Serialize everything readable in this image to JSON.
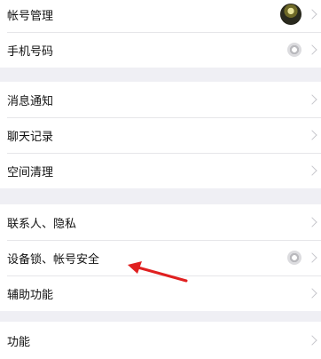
{
  "group1": {
    "items": [
      {
        "label": "帐号管理"
      },
      {
        "label": "手机号码"
      }
    ]
  },
  "group2": {
    "items": [
      {
        "label": "消息通知"
      },
      {
        "label": "聊天记录"
      },
      {
        "label": "空间清理"
      }
    ]
  },
  "group3": {
    "items": [
      {
        "label": "联系人、隐私"
      },
      {
        "label": "设备锁、帐号安全"
      },
      {
        "label": "辅助功能"
      }
    ]
  },
  "group4": {
    "items": [
      {
        "label": "功能"
      }
    ]
  },
  "annotation": {
    "arrow_color": "#e02020"
  }
}
